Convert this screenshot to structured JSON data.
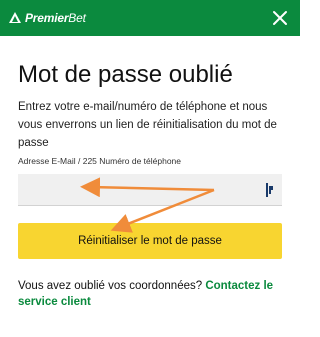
{
  "header": {
    "logo_text_bold": "Premier",
    "logo_text_light": "Bet",
    "close_icon": "close-icon",
    "background_color": "#0b8a3e"
  },
  "form": {
    "title": "Mot de passe oublié",
    "description": "Entrez votre e-mail/numéro de téléphone et nous vous enverrons un lien de réinitialisation du mot de passe",
    "field_label": "Adresse E-Mail / 225 Numéro de téléphone",
    "input_value": "",
    "submit_label": "Réinitialiser le mot de passe",
    "submit_color": "#f8d530"
  },
  "footer": {
    "question": "Vous avez oublié vos coordonnées? ",
    "contact_link": "Contactez le service client",
    "link_color": "#0b8a3e"
  },
  "annotation": {
    "arrow_color": "#f08c3a"
  }
}
